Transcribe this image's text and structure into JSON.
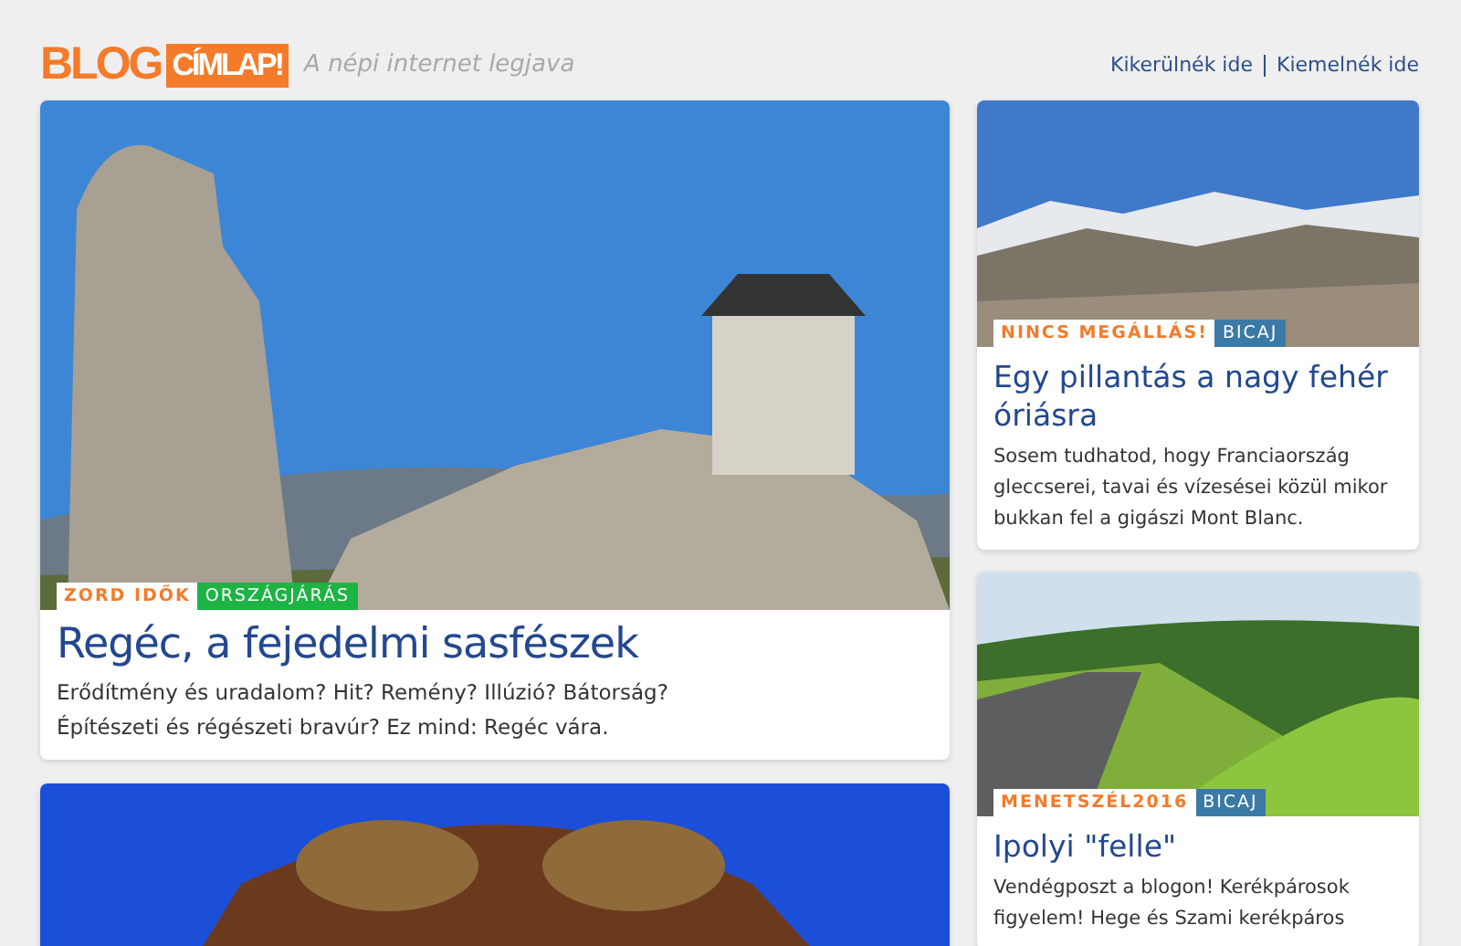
{
  "header": {
    "logo": {
      "part_1": "BLOG",
      "part_2": "CÍMLAP!"
    },
    "tagline": "A népi internet legjava",
    "links": [
      "Kikerülnék ide",
      "Kiemelnék ide"
    ]
  },
  "main_column": [
    {
      "kind": "castle",
      "tags": [
        {
          "label": "ZORD IDŐK",
          "kind": "series"
        },
        {
          "label": "ORSZÁGJÁRÁS",
          "kind": "category",
          "color": "#1db345"
        }
      ],
      "title": "Regéc, a fejedelmi sasfészek",
      "lines": [
        "Erődítmény és uradalom? Hit? Remény? Illúzió? Bátorság?",
        "Építészeti és régészeti bravúr? Ez mind: Regéc vára."
      ]
    },
    {
      "kind": "carousel"
    }
  ],
  "side_column": [
    {
      "kind": "mountains",
      "tags": [
        {
          "label": "NINCS MEGÁLLÁS!",
          "kind": "series"
        },
        {
          "label": "BICAJ",
          "kind": "category",
          "color": "#3c7aa6"
        }
      ],
      "title": "Egy pillantás a nagy fehér óriásra",
      "lines": [
        "Sosem tudhatod, hogy Franciaország gleccserei, tavai és vízesései közül mikor bukkan fel a gigászi Mont Blanc."
      ]
    },
    {
      "kind": "road",
      "tags": [
        {
          "label": "MENETSZÉL2016",
          "kind": "series"
        },
        {
          "label": "BICAJ",
          "kind": "category",
          "color": "#3c7aa6"
        }
      ],
      "title": "Ipolyi \"felle\"",
      "lines": [
        "Vendégposzt a blogon! Kerékpárosok figyelem! Hege és Szami kerékpáros"
      ]
    }
  ]
}
